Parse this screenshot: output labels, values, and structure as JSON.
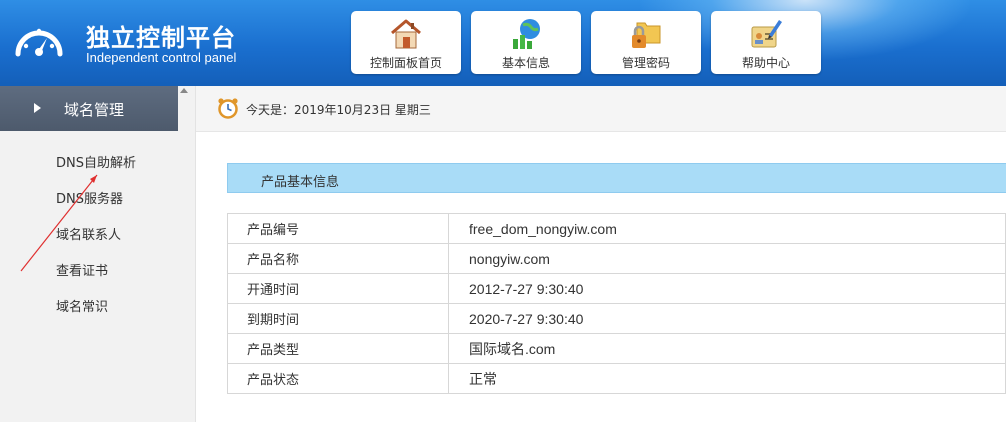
{
  "header": {
    "title": "独立控制平台",
    "subtitle": "Independent control panel",
    "nav": [
      {
        "label": "控制面板首页",
        "icon": "home-icon"
      },
      {
        "label": "基本信息",
        "icon": "globe-chart-icon"
      },
      {
        "label": "管理密码",
        "icon": "lock-folder-icon"
      },
      {
        "label": "帮助中心",
        "icon": "edit-document-icon"
      }
    ]
  },
  "sidebar": {
    "heading": "域名管理",
    "items": [
      {
        "label": "DNS自助解析"
      },
      {
        "label": "DNS服务器"
      },
      {
        "label": "域名联系人"
      },
      {
        "label": "查看证书"
      },
      {
        "label": "域名常识"
      }
    ]
  },
  "date_bar": {
    "text": "今天是：2019年10月23日 星期三",
    "icon": "alarm-clock-icon"
  },
  "panel": {
    "title": "产品基本信息",
    "rows": [
      {
        "key": "产品编号",
        "value": "free_dom_nongyiw.com"
      },
      {
        "key": "产品名称",
        "value": "nongyiw.com"
      },
      {
        "key": "开通时间",
        "value": "2012-7-27 9:30:40"
      },
      {
        "key": "到期时间",
        "value": "2020-7-27 9:30:40"
      },
      {
        "key": "产品类型",
        "value": "国际域名.com"
      },
      {
        "key": "产品状态",
        "value": "正常"
      }
    ]
  },
  "colors": {
    "header_blue": "#1a6fcf",
    "sidebar_head": "#56637a",
    "panel_title_bg": "#a9dcf7",
    "arrow_red": "#e03030"
  }
}
